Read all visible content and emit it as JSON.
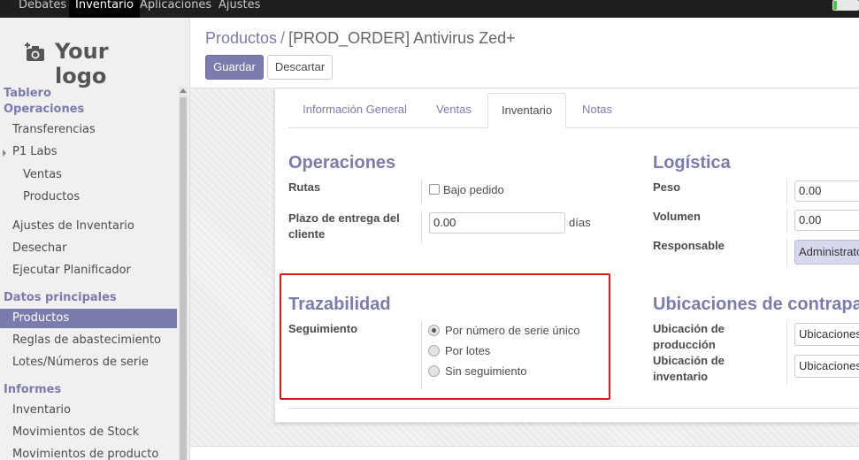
{
  "topbar": {
    "menus": [
      "Debates",
      "Inventario",
      "Aplicaciones",
      "Ajustes"
    ],
    "active_menu": "Inventario"
  },
  "logo": {
    "text": "Your logo",
    "icon": "camera-plus-icon"
  },
  "sidebar": {
    "sections": [
      {
        "heading": "Tablero"
      },
      {
        "heading": "Operaciones"
      },
      {
        "heading": "Datos principales"
      },
      {
        "heading": "Informes"
      }
    ],
    "items": [
      "Transferencias",
      "P1 Labs",
      "Ventas",
      "Productos",
      "Ajustes de Inventario",
      "Desechar",
      "Ejecutar Planificador",
      "Productos",
      "Reglas de abastecimiento",
      "Lotes/Números de serie",
      "Inventario",
      "Movimientos de Stock",
      "Movimientos de producto"
    ],
    "active_item": "Productos"
  },
  "breadcrumb": {
    "parent": "Productos",
    "separator": "/",
    "current": "[PROD_ORDER] Antivirus Zed+"
  },
  "buttons": {
    "save": "Guardar",
    "discard": "Descartar"
  },
  "tabs": [
    "Información General",
    "Ventas",
    "Inventario",
    "Notas"
  ],
  "active_tab": "Inventario",
  "operaciones": {
    "title": "Operaciones",
    "rutas_label": "Rutas",
    "bajo_pedido_label": "Bajo pedido",
    "bajo_pedido_checked": false,
    "plazo_label": "Plazo de entrega del cliente",
    "plazo_value": "0.00",
    "plazo_unit": "días"
  },
  "logistica": {
    "title": "Logística",
    "peso_label": "Peso",
    "peso_value": "0.00",
    "volumen_label": "Volumen",
    "volumen_value": "0.00",
    "responsable_label": "Responsable",
    "responsable_value": "Administrator"
  },
  "trazabilidad": {
    "title": "Trazabilidad",
    "seguimiento_label": "Seguimiento",
    "options": [
      "Por número de serie único",
      "Por lotes",
      "Sin seguimiento"
    ],
    "selected": "Por número de serie único"
  },
  "ubicaciones": {
    "title": "Ubicaciones de contrapartida",
    "produccion_label": "Ubicación de producción",
    "produccion_value": "Ubicaciones virtuales/Producción",
    "inventario_label": "Ubicación de inventario",
    "inventario_value": "Ubicaciones virtuales/Pérdidas de inventario"
  },
  "colors": {
    "brand": "#7c7bad",
    "highlight_box": "#e01a1a",
    "topbar": "#1f1f1f"
  }
}
